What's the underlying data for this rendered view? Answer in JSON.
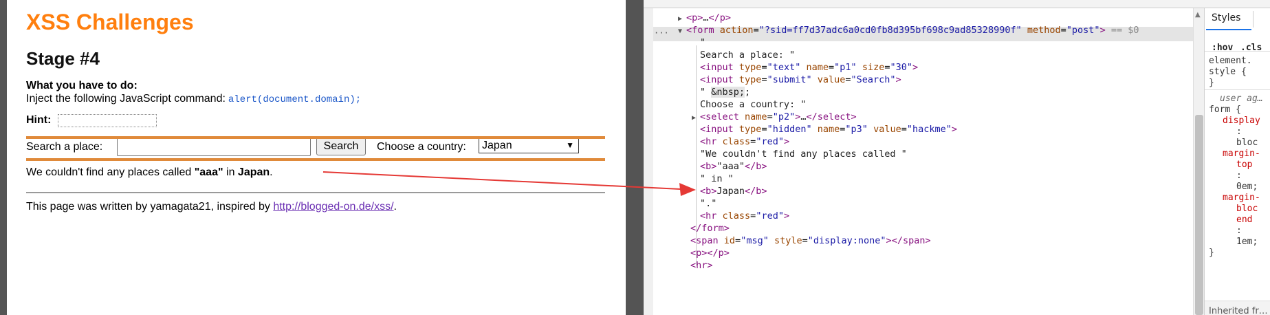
{
  "page": {
    "title": "XSS Challenges",
    "stage": "Stage #4",
    "todo_heading": "What you have to do:",
    "todo_text": "Inject the following JavaScript command:",
    "todo_code": "alert(document.domain);",
    "hint_label": "Hint:",
    "search_label": "Search a place:",
    "search_value": "",
    "search_button": "Search",
    "country_label": "Choose a country:",
    "country_selected": "Japan",
    "result_prefix": "We couldn't find any places called",
    "result_query": "\"aaa\"",
    "result_in": "in",
    "result_country": "Japan",
    "result_suffix": ".",
    "footer_prefix": "This page was written by yamagata21, inspired by",
    "footer_link": "http://blogged-on.de/xss/",
    "footer_suffix": "."
  },
  "devtools": {
    "elements": {
      "p_collapsed": {
        "open": "<p>",
        "ellipsis": "…",
        "close": "</p>"
      },
      "form_open": {
        "tag_open": "<form",
        "action_attr": "action",
        "action_value": "\"?sid=ff7d37adc6a0cd0fb8d395bf698c9ad85328990f\"",
        "method_attr": "method",
        "method_value": "\"post\"",
        "tag_close": ">",
        "selected_marker": "== $0"
      },
      "text_quote": "\"",
      "text_search": "Search a place: \"",
      "input_text": {
        "tag": "<input",
        "a1": "type",
        "v1": "\"text\"",
        "a2": "name",
        "v2": "\"p1\"",
        "a3": "size",
        "v3": "\"30\"",
        "end": ">"
      },
      "input_submit": {
        "tag": "<input",
        "a1": "type",
        "v1": "\"submit\"",
        "a2": "value",
        "v2": "\"Search\"",
        "end": ">"
      },
      "nbsp_quote": "\" ",
      "nbsp_entity": "&nbsp;",
      "text_country": "Choose a country: \"",
      "select": {
        "open": "<select",
        "a1": "name",
        "v1": "\"p2\"",
        "gt": ">",
        "ellipsis": "…",
        "close": "</select>"
      },
      "input_hidden": {
        "tag": "<input",
        "a1": "type",
        "v1": "\"hidden\"",
        "a2": "name",
        "v2": "\"p3\"",
        "a3": "value",
        "v3": "\"hackme\"",
        "end": ">"
      },
      "hr_red_1": {
        "tag": "<hr",
        "a1": "class",
        "v1": "\"red\"",
        "end": ">"
      },
      "text_notfound": "\"We couldn't find any places called \"",
      "b_aaa": {
        "open": "<b>",
        "text": "\"aaa\"",
        "close": "</b>"
      },
      "text_in": "\" in \"",
      "b_japan": {
        "open": "<b>",
        "text": "Japan",
        "close": "</b>"
      },
      "text_dot": "\".\"",
      "hr_red_2": {
        "tag": "<hr",
        "a1": "class",
        "v1": "\"red\"",
        "end": ">"
      },
      "form_close": "</form>",
      "span_msg": {
        "tag": "<span",
        "a1": "id",
        "v1": "\"msg\"",
        "a2": "style",
        "v2": "\"display:none\"",
        "mid": ">",
        "close": "</span>"
      },
      "p_empty": {
        "open": "<p>",
        "close": "</p>"
      },
      "hr_plain": "<hr>",
      "ellipsis_menu": "···"
    },
    "styles": {
      "tab_label": "Styles",
      "hov": ":hov",
      "cls": ".cls",
      "element_style_1": "element.",
      "element_style_2": "style {",
      "element_style_3": "}",
      "user_agent": "user ag…",
      "form_selector": "form {",
      "p_display": "display",
      "colon": ":",
      "v_bloc": "bloc",
      "p_margin": "margin-",
      "p_top": "top",
      "v_0em": "0em;",
      "p_margin2": "margin-",
      "p_bloc": "bloc",
      "p_end": "end",
      "v_1em": "1em;",
      "close_brace": "}",
      "inherited": "Inherited fr…"
    }
  },
  "colors": {
    "title_orange": "#ff7f0e",
    "hr_orange": "#e08a3a",
    "arrow_red": "#e53935",
    "link_purple": "#6b2fb3",
    "dt_tag": "#881280",
    "dt_attr": "#994500",
    "dt_value": "#1a1aa6"
  }
}
